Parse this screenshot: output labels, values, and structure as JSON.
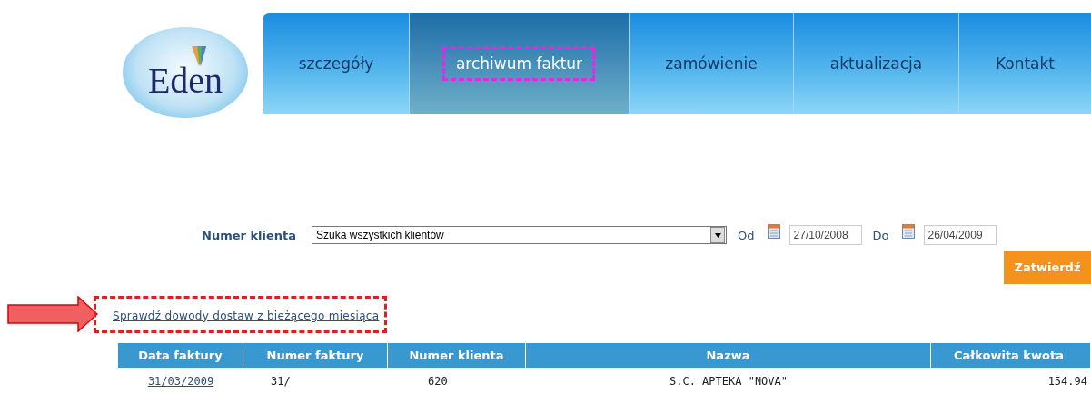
{
  "logo": {
    "text": "Eden"
  },
  "tabs": [
    {
      "label": "szczegóły",
      "selected": false
    },
    {
      "label": "archiwum faktur",
      "selected": true
    },
    {
      "label": "zamówienie",
      "selected": false
    },
    {
      "label": "aktualizacja",
      "selected": false
    },
    {
      "label": "Kontakt",
      "selected": false
    }
  ],
  "filter": {
    "client_label": "Numer klienta",
    "client_value": "Szuka wszystkich klientów",
    "from_label": "Od",
    "from_value": "27/10/2008",
    "to_label": "Do",
    "to_value": "26/04/2009",
    "submit": "Zatwierdź"
  },
  "delivery_link": "Sprawdź dowody dostaw z bieżącego miesiąca",
  "table": {
    "columns": [
      "Data faktury",
      "Numer faktury",
      "Numer klienta",
      "Nazwa",
      "Całkowita kwota"
    ],
    "rows": [
      [
        "31/03/2009",
        "31/",
        "620",
        "S.C. APTEKA \"NOVA\"",
        "154.94"
      ]
    ]
  }
}
